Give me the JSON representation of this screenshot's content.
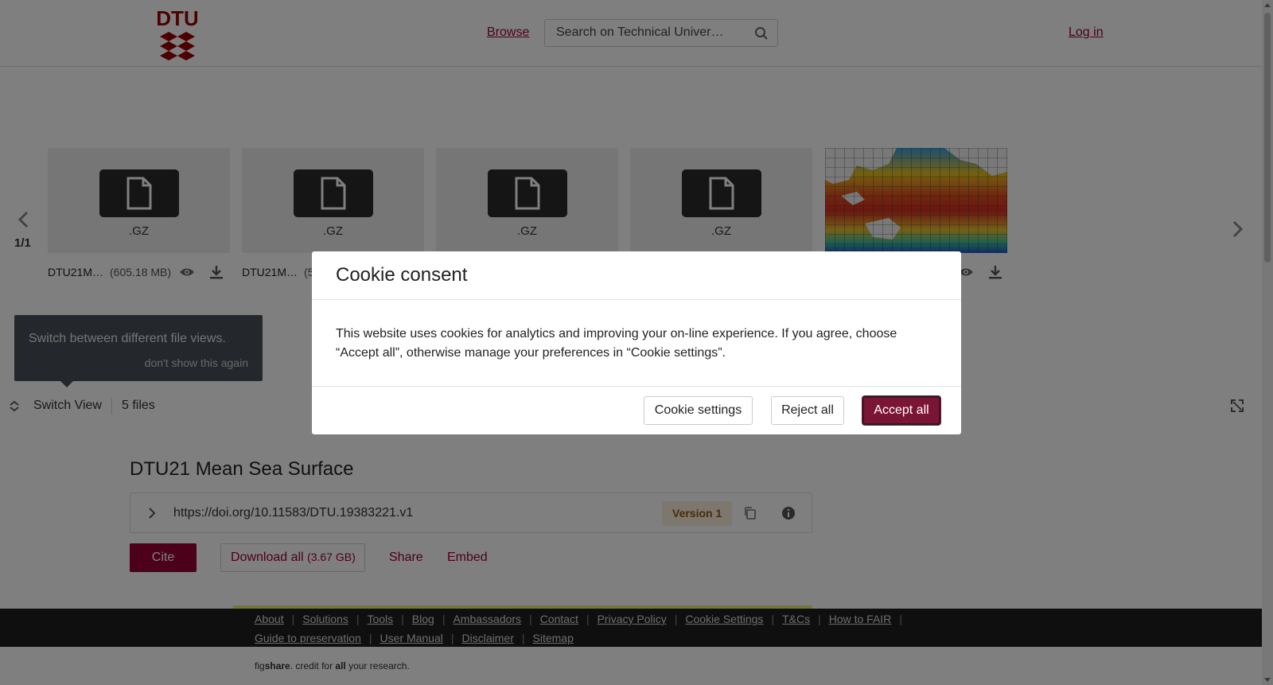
{
  "header": {
    "browse_label": "Browse",
    "search_placeholder": "Search on Technical Univer…",
    "login_label": "Log in",
    "logo_text": "DTU"
  },
  "carousel": {
    "pager": "1/1",
    "files": [
      {
        "ext": ".GZ",
        "name": "DTU21M…",
        "size": "(605.18 MB)"
      },
      {
        "ext": ".GZ",
        "name": "DTU21M…",
        "size": "(5"
      },
      {
        "ext": ".GZ"
      },
      {
        "ext": ".GZ"
      },
      {
        "ext": "",
        "preview": "sea-surface-map"
      }
    ]
  },
  "tooltip": {
    "text": "Switch between different file views.",
    "dismiss": "don't show this again"
  },
  "viewbar": {
    "switch_label": "Switch View",
    "file_count": "5 files"
  },
  "article": {
    "title": "DTU21 Mean Sea Surface",
    "doi": "https://doi.org/10.11583/DTU.19383221.v1",
    "version": "Version 1",
    "cite_label": "Cite",
    "download_label": "Download all",
    "download_size": "(3.67 GB)",
    "share_label": "Share",
    "embed_label": "Embed"
  },
  "footer": {
    "links_row1": [
      "About",
      "Solutions",
      "Tools",
      "Blog",
      "Ambassadors",
      "Contact",
      "Privacy Policy",
      "Cookie Settings",
      "T&Cs",
      "How to FAIR"
    ],
    "links_row2": [
      "Guide to preservation",
      "User Manual",
      "Disclaimer",
      "Sitemap"
    ],
    "credit_pre": "fig",
    "credit_bold": "share",
    "credit_mid": ". credit for ",
    "credit_bold2": "all",
    "credit_post": " your research."
  },
  "cookie": {
    "title": "Cookie consent",
    "body": "This website uses cookies for analytics and improving your on-line experience. If you agree, choose “Accept all”, otherwise manage your preferences in “Cookie settings”.",
    "settings_label": "Cookie settings",
    "reject_label": "Reject all",
    "accept_label": "Accept all"
  },
  "colors": {
    "brand": "#990033",
    "accept_button": "#7a1535",
    "footer_bg": "#1f1f1f"
  }
}
